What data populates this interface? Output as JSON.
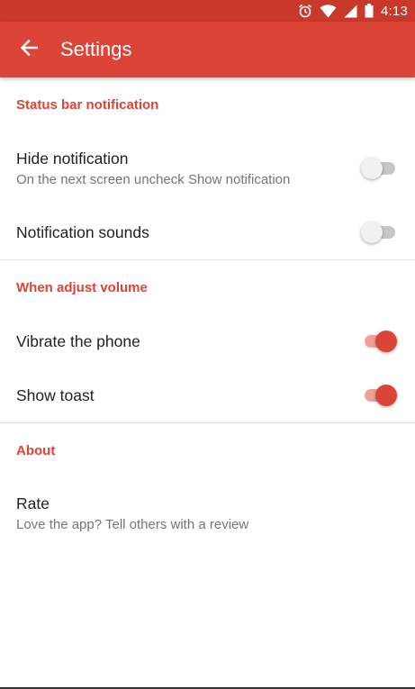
{
  "status_bar": {
    "time": "4:13",
    "icons": [
      "alarm-icon",
      "wifi-icon",
      "signal-icon",
      "battery-icon"
    ]
  },
  "app_bar": {
    "title": "Settings",
    "back_icon": "arrow-back-icon"
  },
  "colors": {
    "primary": "#DB4437",
    "primary_dark": "#C8392B",
    "switch_on_track": "#F0A097",
    "switch_off_track": "#C6C6C6"
  },
  "sections": [
    {
      "header": "Status bar notification",
      "items": [
        {
          "title": "Hide notification",
          "subtitle": "On the next screen uncheck Show notification",
          "toggle": false
        },
        {
          "title": "Notification sounds",
          "toggle": false
        }
      ]
    },
    {
      "header": "When adjust volume",
      "items": [
        {
          "title": "Vibrate the phone",
          "toggle": true
        },
        {
          "title": "Show toast",
          "toggle": true
        }
      ]
    },
    {
      "header": "About",
      "items": [
        {
          "title": "Rate",
          "subtitle": "Love the app? Tell others with a review"
        }
      ]
    }
  ]
}
